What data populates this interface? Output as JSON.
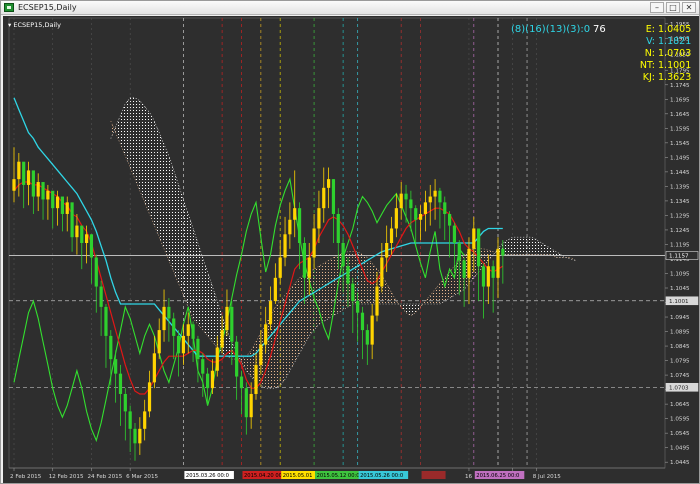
{
  "window": {
    "title": "ECSEP15,Daily",
    "minimize_label": "–",
    "maximize_label": "□",
    "close_label": "✕"
  },
  "chart_data": {
    "type": "candlestick",
    "symbol_label": "ECSEP15,Daily",
    "indicator_params": "(8)(16)(13)(3):0",
    "indicator_value": "76",
    "readouts": [
      {
        "label": "E:",
        "value": "1.0405",
        "color": "#ffff00"
      },
      {
        "label": "V:",
        "value": "1.1821",
        "color": "#2fd6e6"
      },
      {
        "label": "N:",
        "value": "1.0703",
        "color": "#ffff00"
      },
      {
        "label": "NT:",
        "value": "1.1001",
        "color": "#ffff00"
      },
      {
        "label": "KJ:",
        "value": "1.3623",
        "color": "#ffff00"
      }
    ],
    "ylim": [
      1.0425,
      1.1975
    ],
    "y_ticks": [
      "1.1955",
      "1.1905",
      "1.1850",
      "1.1795",
      "1.1745",
      "1.1695",
      "1.1645",
      "1.1595",
      "1.1545",
      "1.1495",
      "1.1445",
      "1.1395",
      "1.1345",
      "1.1295",
      "1.1245",
      "1.1195",
      "1.1145",
      "1.1095",
      "1.1045",
      "1.0995",
      "1.0945",
      "1.0895",
      "1.0845",
      "1.0795",
      "1.0745",
      "1.0695",
      "1.0645",
      "1.0595",
      "1.0545",
      "1.0495",
      "1.0445"
    ],
    "price_tags": [
      {
        "value": 1.1157,
        "label": "1.1157",
        "line_color": "#d0d0d0"
      },
      {
        "value": 1.1001,
        "label": "1.1001",
        "line_color": "#bdbdbd"
      },
      {
        "value": 1.0703,
        "label": "1.0703",
        "line_color": "#bdbdbd"
      }
    ],
    "x_ticks": [
      {
        "i": 0,
        "label": "2 Feb 2015"
      },
      {
        "i": 8,
        "label": "12 Feb 2015"
      },
      {
        "i": 16,
        "label": "24 Feb 2015"
      },
      {
        "i": 24,
        "label": "6 Mar 2015"
      },
      {
        "i": 94,
        "label": "16"
      },
      {
        "i": 103,
        "label": "2015"
      },
      {
        "i": 108,
        "label": "8 Jul 2015"
      }
    ],
    "date_markers": [
      {
        "i": 35,
        "label": "2015.03.26 00:0",
        "bg": "#ffffff",
        "fg": "#000000",
        "line": "#cccccc"
      },
      {
        "i": 43,
        "label": "",
        "bg": "",
        "fg": "",
        "line": "#d02020"
      },
      {
        "i": 47,
        "label": "2015.04.20 00:0",
        "bg": "#d02020",
        "fg": "#000000",
        "line": "#d02020"
      },
      {
        "i": 51,
        "label": "",
        "bg": "",
        "fg": "",
        "line": "#e0b020"
      },
      {
        "i": 55,
        "label": "2015.05.01",
        "bg": "#ffe000",
        "fg": "#000000",
        "line": "#e0d000"
      },
      {
        "i": 62,
        "label": "2015.05.12 00:0",
        "bg": "#3ec43e",
        "fg": "#000000",
        "line": "#3ec43e"
      },
      {
        "i": 68,
        "label": "",
        "bg": "",
        "fg": "",
        "line": "#20c0c0"
      },
      {
        "i": 71,
        "label": "2015.05.26 00:0",
        "bg": "#38c8d8",
        "fg": "#000000",
        "line": "#38c8d8"
      },
      {
        "i": 80,
        "label": "",
        "bg": "",
        "fg": "",
        "line": "#c03030"
      },
      {
        "i": 84,
        "label": "",
        "bg": "#9a2a2a",
        "fg": "#000000",
        "line": "#b03030"
      },
      {
        "i": 95,
        "label": "2015.06.25 00:0",
        "bg": "#c070c0",
        "fg": "#000000",
        "line": "#c070c0"
      },
      {
        "i": 100,
        "label": "",
        "bg": "",
        "fg": "",
        "line": "#e0e0e0"
      },
      {
        "i": 106,
        "label": "",
        "bg": "",
        "fg": "",
        "line": "#bbbbbb"
      }
    ],
    "series_colors": {
      "bull_candle": "#ffd400",
      "bear_candle": "#2ed12e",
      "tenkan": "#e21616",
      "kijun": "#2fd6e6",
      "chikou": "#33e02e",
      "cloud_a": "#e8b890",
      "cloud_b": "#ffffff"
    },
    "close": [
      1.142,
      1.148,
      1.14,
      1.145,
      1.136,
      1.141,
      1.135,
      1.138,
      1.132,
      1.136,
      1.13,
      1.134,
      1.122,
      1.126,
      1.12,
      1.123,
      1.115,
      1.105,
      1.098,
      1.088,
      1.08,
      1.075,
      1.068,
      1.062,
      1.056,
      1.051,
      1.056,
      1.062,
      1.072,
      1.082,
      1.09,
      1.098,
      1.094,
      1.088,
      1.082,
      1.088,
      1.092,
      1.087,
      1.08,
      1.075,
      1.07,
      1.076,
      1.084,
      1.09,
      1.098,
      1.086,
      1.074,
      1.07,
      1.06,
      1.068,
      1.078,
      1.085,
      1.092,
      1.1,
      1.108,
      1.115,
      1.123,
      1.128,
      1.132,
      1.12,
      1.108,
      1.115,
      1.125,
      1.132,
      1.139,
      1.142,
      1.13,
      1.12,
      1.112,
      1.106,
      1.1,
      1.096,
      1.09,
      1.085,
      1.095,
      1.105,
      1.115,
      1.12,
      1.125,
      1.132,
      1.137,
      1.135,
      1.132,
      1.128,
      1.13,
      1.134,
      1.136,
      1.138,
      1.134,
      1.13,
      1.126,
      1.12,
      1.114,
      1.108,
      1.118,
      1.125,
      1.112,
      1.105,
      1.112,
      1.108,
      1.118,
      1.1157
    ],
    "high": [
      1.153,
      1.151,
      1.146,
      1.148,
      1.143,
      1.144,
      1.139,
      1.14,
      1.137,
      1.138,
      1.135,
      1.136,
      1.13,
      1.13,
      1.125,
      1.126,
      1.123,
      1.116,
      1.107,
      1.099,
      1.09,
      1.083,
      1.078,
      1.07,
      1.064,
      1.058,
      1.06,
      1.066,
      1.076,
      1.088,
      1.094,
      1.104,
      1.101,
      1.096,
      1.09,
      1.092,
      1.096,
      1.093,
      1.088,
      1.082,
      1.077,
      1.08,
      1.088,
      1.095,
      1.104,
      1.1,
      1.088,
      1.076,
      1.072,
      1.072,
      1.082,
      1.09,
      1.098,
      1.105,
      1.113,
      1.121,
      1.129,
      1.134,
      1.145,
      1.134,
      1.122,
      1.12,
      1.13,
      1.138,
      1.146,
      1.146,
      1.142,
      1.132,
      1.122,
      1.115,
      1.108,
      1.103,
      1.098,
      1.092,
      1.099,
      1.11,
      1.12,
      1.126,
      1.129,
      1.137,
      1.141,
      1.14,
      1.138,
      1.133,
      1.133,
      1.138,
      1.14,
      1.142,
      1.139,
      1.136,
      1.131,
      1.127,
      1.121,
      1.115,
      1.122,
      1.129,
      1.123,
      1.113,
      1.116,
      1.114,
      1.122,
      1.121
    ],
    "low": [
      1.134,
      1.136,
      1.132,
      1.133,
      1.13,
      1.131,
      1.128,
      1.128,
      1.125,
      1.126,
      1.124,
      1.124,
      1.117,
      1.116,
      1.111,
      1.113,
      1.106,
      1.096,
      1.088,
      1.077,
      1.071,
      1.065,
      1.057,
      1.052,
      1.048,
      1.045,
      1.047,
      1.052,
      1.06,
      1.07,
      1.08,
      1.086,
      1.086,
      1.08,
      1.074,
      1.078,
      1.082,
      1.079,
      1.072,
      1.067,
      1.064,
      1.068,
      1.074,
      1.082,
      1.088,
      1.078,
      1.066,
      1.061,
      1.054,
      1.056,
      1.066,
      1.075,
      1.082,
      1.09,
      1.099,
      1.106,
      1.112,
      1.118,
      1.122,
      1.111,
      1.099,
      1.102,
      1.111,
      1.12,
      1.127,
      1.132,
      1.12,
      1.111,
      1.103,
      1.098,
      1.089,
      1.086,
      1.08,
      1.078,
      1.08,
      1.093,
      1.103,
      1.11,
      1.116,
      1.122,
      1.128,
      1.127,
      1.124,
      1.119,
      1.121,
      1.124,
      1.126,
      1.128,
      1.125,
      1.121,
      1.115,
      1.11,
      1.102,
      1.098,
      1.099,
      1.11,
      1.1,
      1.094,
      1.099,
      1.096,
      1.101,
      1.106
    ],
    "tenkan": [
      1.138,
      1.14,
      1.141,
      1.141,
      1.14,
      1.14,
      1.139,
      1.138,
      1.137,
      1.136,
      1.134,
      1.133,
      1.13,
      1.129,
      1.126,
      1.124,
      1.12,
      1.114,
      1.108,
      1.102,
      1.096,
      1.09,
      1.084,
      1.078,
      1.073,
      1.069,
      1.068,
      1.068,
      1.07,
      1.073,
      1.076,
      1.079,
      1.081,
      1.081,
      1.081,
      1.081,
      1.082,
      1.083,
      1.083,
      1.082,
      1.08,
      1.079,
      1.079,
      1.08,
      1.082,
      1.083,
      1.081,
      1.078,
      1.073,
      1.07,
      1.07,
      1.072,
      1.076,
      1.081,
      1.087,
      1.093,
      1.099,
      1.105,
      1.111,
      1.113,
      1.114,
      1.115,
      1.118,
      1.122,
      1.125,
      1.128,
      1.129,
      1.128,
      1.126,
      1.123,
      1.119,
      1.115,
      1.111,
      1.107,
      1.106,
      1.107,
      1.11,
      1.113,
      1.116,
      1.119,
      1.122,
      1.125,
      1.127,
      1.128,
      1.129,
      1.13,
      1.131,
      1.132,
      1.132,
      1.131,
      1.13,
      1.127,
      1.124,
      1.12,
      1.118,
      1.117,
      1.115,
      1.113,
      1.111,
      1.11,
      1.111,
      1.112
    ],
    "kijun": [
      1.17,
      1.166,
      1.162,
      1.158,
      1.156,
      1.153,
      1.151,
      1.149,
      1.147,
      1.145,
      1.143,
      1.141,
      1.139,
      1.137,
      1.134,
      1.131,
      1.128,
      1.124,
      1.119,
      1.114,
      1.108,
      1.103,
      1.099,
      1.099,
      1.099,
      1.099,
      1.099,
      1.099,
      1.099,
      1.099,
      1.097,
      1.095,
      1.093,
      1.091,
      1.089,
      1.087,
      1.085,
      1.083,
      1.081,
      1.081,
      1.081,
      1.081,
      1.081,
      1.081,
      1.081,
      1.081,
      1.081,
      1.081,
      1.081,
      1.081,
      1.082,
      1.084,
      1.086,
      1.088,
      1.09,
      1.092,
      1.094,
      1.096,
      1.098,
      1.1,
      1.101,
      1.102,
      1.103,
      1.104,
      1.105,
      1.106,
      1.107,
      1.108,
      1.109,
      1.11,
      1.111,
      1.112,
      1.113,
      1.114,
      1.115,
      1.116,
      1.117,
      1.1175,
      1.118,
      1.1185,
      1.119,
      1.1195,
      1.12,
      1.12,
      1.12,
      1.12,
      1.12,
      1.12,
      1.12,
      1.12,
      1.12,
      1.12,
      1.12,
      1.12,
      1.12,
      1.12,
      1.122,
      1.124,
      1.125,
      1.125,
      1.125,
      1.125
    ],
    "chikou": [
      1.072,
      1.08,
      1.088,
      1.096,
      1.1,
      1.094,
      1.086,
      1.078,
      1.07,
      1.064,
      1.06,
      1.064,
      1.07,
      1.076,
      1.07,
      1.062,
      1.056,
      1.052,
      1.058,
      1.066,
      1.074,
      1.082,
      1.09,
      1.098,
      1.094,
      1.088,
      1.082,
      1.088,
      1.092,
      1.088,
      1.082,
      1.076,
      1.072,
      1.078,
      1.084,
      1.092,
      1.098,
      1.088,
      1.076,
      1.072,
      1.064,
      1.07,
      1.08,
      1.086,
      1.093,
      1.101,
      1.109,
      1.116,
      1.124,
      1.13,
      1.134,
      1.122,
      1.11,
      1.116,
      1.126,
      1.133,
      1.138,
      1.142,
      1.132,
      1.122,
      1.113,
      1.107,
      1.101,
      1.097,
      1.091,
      1.087,
      1.096,
      1.106,
      1.115,
      1.12,
      1.125,
      1.132,
      1.136,
      1.134,
      1.131,
      1.127,
      1.13,
      1.133,
      1.135,
      1.137,
      1.133,
      1.129,
      1.125,
      1.119,
      1.113,
      1.108,
      1.117,
      1.124,
      1.111,
      1.105,
      1.111,
      1.108,
      1.118,
      1.1157
    ],
    "cloud_start": 20,
    "span_a": [
      1.162,
      1.158,
      1.154,
      1.15,
      1.146,
      1.142,
      1.138,
      1.134,
      1.13,
      1.126,
      1.122,
      1.118,
      1.114,
      1.11,
      1.106,
      1.102,
      1.098,
      1.094,
      1.092,
      1.09,
      1.088,
      1.086,
      1.084,
      1.082,
      1.081,
      1.08,
      1.08,
      1.08,
      1.081,
      1.083,
      1.086,
      1.089,
      1.092,
      1.095,
      1.098,
      1.1,
      1.102,
      1.104,
      1.106,
      1.108,
      1.109,
      1.11,
      1.111,
      1.112,
      1.113,
      1.114,
      1.115,
      1.116,
      1.1165,
      1.117,
      1.117,
      1.117,
      1.116,
      1.115,
      1.113,
      1.111,
      1.109,
      1.106,
      1.103,
      1.1,
      1.098,
      1.096,
      1.095,
      1.096,
      1.098,
      1.1,
      1.102,
      1.104,
      1.106,
      1.108,
      1.11,
      1.112,
      1.114,
      1.116,
      1.117,
      1.118,
      1.118,
      1.118,
      1.1175,
      1.117,
      1.1165,
      1.116,
      1.116,
      1.116,
      1.116,
      1.116,
      1.116,
      1.116,
      1.116,
      1.116,
      1.116,
      1.116,
      1.115,
      1.115,
      1.115,
      1.115,
      1.114
    ],
    "span_b": [
      1.156,
      1.16,
      1.164,
      1.168,
      1.17,
      1.17,
      1.169,
      1.167,
      1.165,
      1.162,
      1.158,
      1.154,
      1.15,
      1.145,
      1.14,
      1.135,
      1.13,
      1.125,
      1.12,
      1.115,
      1.11,
      1.105,
      1.1,
      1.095,
      1.09,
      1.086,
      1.082,
      1.079,
      1.076,
      1.074,
      1.072,
      1.071,
      1.07,
      1.07,
      1.07,
      1.071,
      1.073,
      1.076,
      1.079,
      1.082,
      1.085,
      1.088,
      1.09,
      1.092,
      1.093,
      1.094,
      1.095,
      1.096,
      1.097,
      1.098,
      1.099,
      1.099,
      1.099,
      1.099,
      1.099,
      1.099,
      1.099,
      1.099,
      1.099,
      1.099,
      1.099,
      1.099,
      1.099,
      1.099,
      1.099,
      1.099,
      1.099,
      1.099,
      1.099,
      1.1,
      1.101,
      1.102,
      1.103,
      1.104,
      1.106,
      1.108,
      1.11,
      1.112,
      1.114,
      1.116,
      1.118,
      1.12,
      1.121,
      1.122,
      1.122,
      1.122,
      1.122,
      1.122,
      1.121,
      1.12,
      1.119,
      1.118,
      1.117,
      1.116,
      1.115,
      1.1145,
      1.114
    ]
  }
}
